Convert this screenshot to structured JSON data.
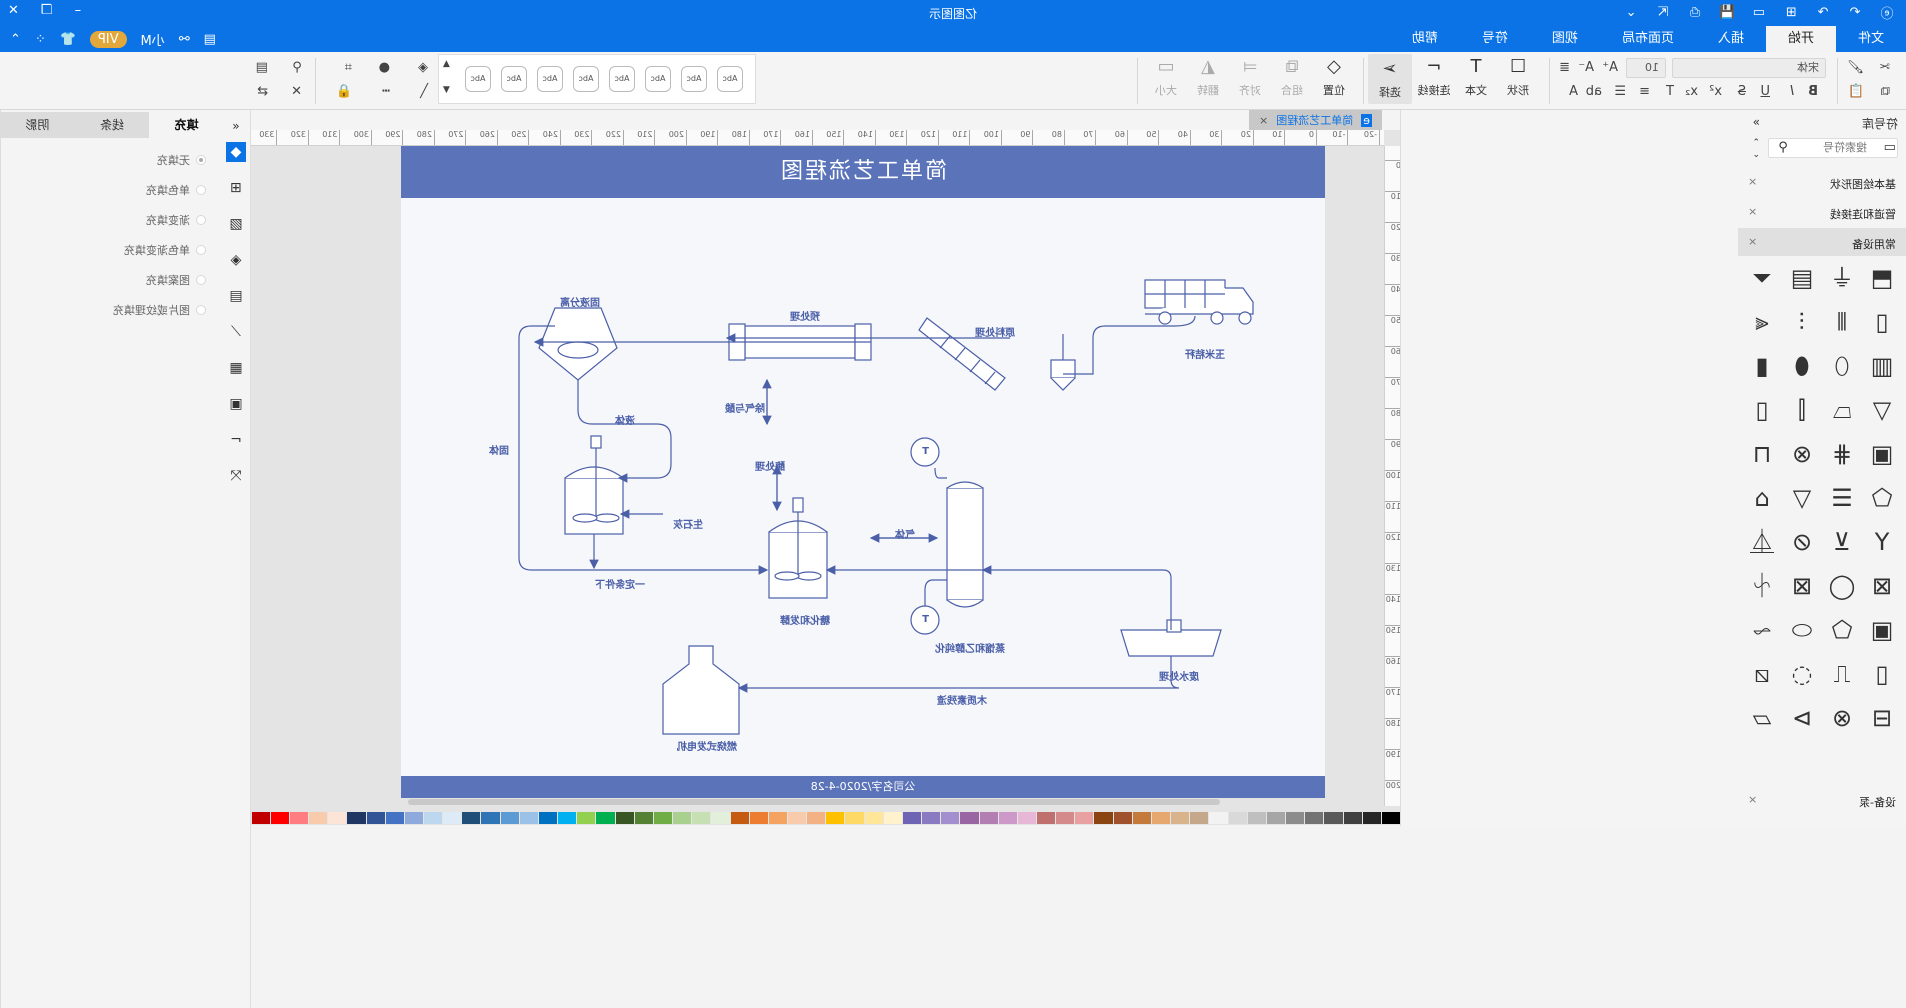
{
  "app": {
    "title": "亿图图示",
    "menu_tabs": [
      "文件",
      "开始",
      "插入",
      "页面布局",
      "视图",
      "符号",
      "帮助"
    ],
    "active_menu": "开始",
    "user": "小M",
    "vip_label": "VIP"
  },
  "ribbon": {
    "font_name": "宋体",
    "font_size": "10",
    "tools": [
      {
        "label": "形状",
        "icon": "rectangle-icon"
      },
      {
        "label": "文本",
        "icon": "text-icon"
      },
      {
        "label": "连接线",
        "icon": "connector-icon"
      },
      {
        "label": "选择",
        "icon": "select-arrow-icon"
      }
    ],
    "arrange": [
      {
        "label": "位置",
        "icon": "layers-icon"
      },
      {
        "label": "组合",
        "icon": "group-icon"
      },
      {
        "label": "对齐",
        "icon": "align-icon"
      },
      {
        "label": "翻转",
        "icon": "flip-icon"
      },
      {
        "label": "大小",
        "icon": "size-icon"
      }
    ],
    "style_chip_label": "Abc",
    "style_chip_count": 8
  },
  "fill_panel": {
    "tabs": [
      "填充",
      "线条",
      "阴影"
    ],
    "active_tab": "填充",
    "options": [
      {
        "label": "无填充",
        "selected": true
      },
      {
        "label": "单色填充",
        "selected": false
      },
      {
        "label": "渐变填充",
        "selected": false
      },
      {
        "label": "单色渐变填充",
        "selected": false
      },
      {
        "label": "图案填充",
        "selected": false
      },
      {
        "label": "图片或纹理填充",
        "selected": false
      }
    ]
  },
  "document": {
    "tab_title": "简单工艺流程图",
    "page_title": "简单工艺流程图",
    "footer": "公司名字/2020-4-28",
    "ruler_h": [
      "-20",
      "-10",
      "0",
      "10",
      "20",
      "30",
      "40",
      "50",
      "60",
      "70",
      "80",
      "90",
      "100",
      "110",
      "120",
      "130",
      "140",
      "150",
      "160",
      "170",
      "180",
      "190",
      "200",
      "210",
      "220",
      "230",
      "240",
      "250",
      "260",
      "270",
      "280",
      "290",
      "300",
      "310",
      "320",
      "330"
    ],
    "ruler_v": [
      "0",
      "10",
      "20",
      "30",
      "40",
      "50",
      "60",
      "70",
      "80",
      "90",
      "100",
      "110",
      "120",
      "130",
      "140",
      "150",
      "160",
      "170",
      "180",
      "190",
      "200"
    ]
  },
  "diagram": {
    "labels": {
      "solid_liquid_sep": "固液分离",
      "pretreatment": "预处理",
      "raw_material": "原料处理",
      "corn_stalk": "玉米秸秆",
      "solid": "固体",
      "liquid": "液体",
      "quicklime": "生石灰",
      "certain_condition": "一定条件下",
      "degas_acid": "除气与酸",
      "enzyme": "酶处理",
      "saccharify": "糖化和发酵",
      "gas": "气体",
      "distill": "蒸馏和乙醇纯化",
      "wastewater": "废水处理",
      "lignin": "木质素残渣",
      "boiler": "燃烧式发电机",
      "t1": "T",
      "t2": "T"
    }
  },
  "library": {
    "title": "符号库",
    "search_placeholder": "搜索符号",
    "categories": [
      {
        "name": "基本绘图形状",
        "open": false
      },
      {
        "name": "管道和连接线",
        "open": false
      },
      {
        "name": "常用设备",
        "open": true
      },
      {
        "name": "设备-泵",
        "open": false
      }
    ]
  },
  "palette": [
    "#000000",
    "#262626",
    "#404040",
    "#595959",
    "#737373",
    "#8c8c8c",
    "#a6a6a6",
    "#bfbfbf",
    "#d9d9d9",
    "#f2f2f2",
    "#c5a88a",
    "#d9b38c",
    "#e6a86e",
    "#c47a3a",
    "#a0522d",
    "#8b4513",
    "#e8a0a0",
    "#d48a8a",
    "#c06f6f",
    "#e6b8d6",
    "#cc99c9",
    "#b37fb3",
    "#9966a3",
    "#a38fd0",
    "#8a7ac2",
    "#6f63b3",
    "#fff2cc",
    "#ffe699",
    "#ffd966",
    "#ffc000",
    "#f4b183",
    "#f8cbad",
    "#f4a460",
    "#ed7d31",
    "#c55a11",
    "#e2efda",
    "#c6e0b4",
    "#a9d08e",
    "#70ad47",
    "#548235",
    "#375623",
    "#00b050",
    "#92d050",
    "#00b0f0",
    "#0070c0",
    "#9bc2e6",
    "#5b9bd5",
    "#2f75b5",
    "#1f4e78",
    "#ddebf7",
    "#bdd7ee",
    "#8ea9db",
    "#4472c4",
    "#305496",
    "#203764",
    "#fce4d6",
    "#f8cbad",
    "#ff7c80",
    "#ff0000",
    "#c00000"
  ]
}
